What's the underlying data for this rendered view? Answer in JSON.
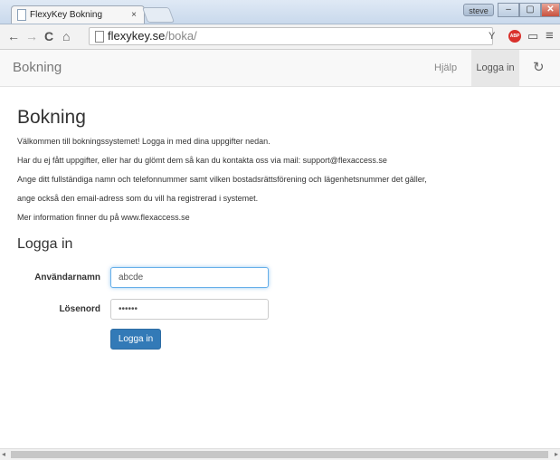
{
  "browser": {
    "tab_title": "FlexyKey Bokning",
    "tab_close": "×",
    "user_badge": "steve",
    "win_min": "–",
    "win_max": "▢",
    "win_close": "✕",
    "back": "←",
    "forward": "→",
    "reload": "C",
    "home": "⌂",
    "url_host": "flexykey.se",
    "url_path": "/boka/",
    "abp_label": "ABP",
    "cast_icon": "▭",
    "menu_icon": "≡",
    "ext_icon": "Y"
  },
  "navbar": {
    "brand": "Bokning",
    "help": "Hjälp",
    "login": "Logga in",
    "refresh": "↻"
  },
  "page": {
    "title": "Bokning",
    "paragraphs": [
      "Välkommen till bokningssystemet! Logga in med dina uppgifter nedan.",
      "Har du ej fått uppgifter, eller har du glömt dem så kan du kontakta oss via mail: support@flexaccess.se",
      "Ange ditt fullständiga namn och telefonnummer samt vilken bostadsrättsförening och lägenhetsnummer det gäller,",
      "ange också den email-adress som du vill ha registrerad i systemet.",
      "Mer information finner du på www.flexaccess.se"
    ]
  },
  "login_form": {
    "title": "Logga in",
    "username_label": "Användarnamn",
    "username_value": "abcde",
    "password_label": "Lösenord",
    "password_value": "••••••",
    "submit": "Logga in"
  },
  "colors": {
    "primary_button": "#337ab7",
    "navbar_bg": "#f8f8f8",
    "active_nav": "#e7e7e7"
  }
}
